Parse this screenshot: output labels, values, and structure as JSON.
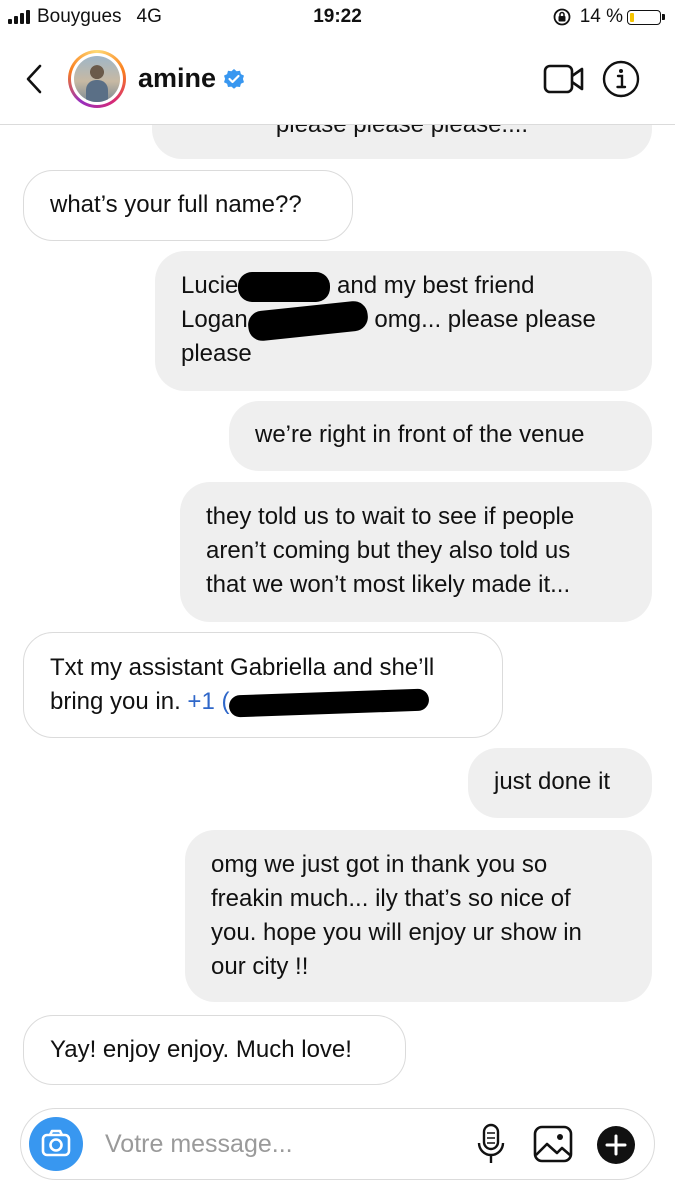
{
  "status_bar": {
    "carrier": "Bouygues",
    "network": "4G",
    "time": "19:22",
    "battery_percent": "14 %",
    "battery_level": 0.14
  },
  "header": {
    "contact_name": "amine",
    "verified": true
  },
  "messages": [
    {
      "direction": "outgoing",
      "lines": [
        "please please please...."
      ]
    },
    {
      "direction": "incoming",
      "lines": [
        "what’s your full name??"
      ]
    },
    {
      "direction": "outgoing",
      "lines": [
        "Lucie",
        "and my best friend",
        "Logan",
        "omg... please please",
        "please"
      ]
    },
    {
      "direction": "outgoing",
      "lines": [
        "we’re right in front of the venue"
      ]
    },
    {
      "direction": "outgoing",
      "lines": [
        "they told us to wait to see if people",
        "aren’t coming but they also told us",
        "that we won’t most likely made it..."
      ]
    },
    {
      "direction": "incoming",
      "lines": [
        "Txt my assistant Gabriella and she’ll",
        "bring you in.",
        "+1 ("
      ]
    },
    {
      "direction": "outgoing",
      "lines": [
        "just done it"
      ]
    },
    {
      "direction": "outgoing",
      "lines": [
        "omg we just got in thank you so",
        "freakin much... ily that’s so nice of",
        "you. hope you will enjoy ur show in",
        "our city !!"
      ]
    },
    {
      "direction": "incoming",
      "lines": [
        "Yay! enjoy enjoy. Much love!"
      ]
    }
  ],
  "composer": {
    "placeholder": "Votre message...",
    "accent_color": "#3897f0"
  },
  "colors": {
    "outgoing_bubble": "#efefef",
    "incoming_border": "#dbdbdb",
    "verified_badge": "#3897f0",
    "battery_fill": "#f5c400"
  }
}
